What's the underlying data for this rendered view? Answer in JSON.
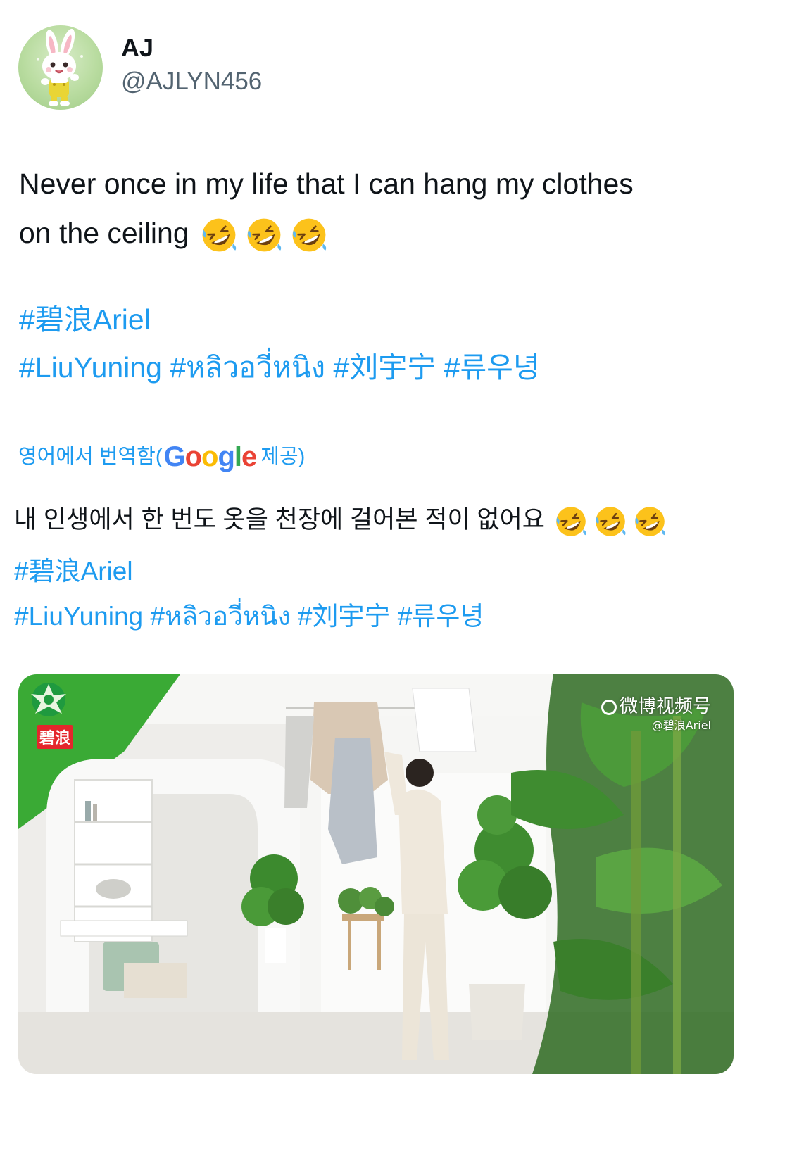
{
  "author": {
    "display_name": "AJ",
    "handle": "@AJLYN456",
    "avatar_icon": "rabbit-avatar"
  },
  "tweet": {
    "text_line1": "Never once in my life that I can hang my clothes",
    "text_line2": "on the ceiling",
    "emoji": "rolling-on-the-floor-laughing",
    "hashtags_line1": [
      "#碧浪Ariel"
    ],
    "hashtags_line2": [
      "#LiuYuning",
      "#หลิวอวี่หนิง",
      "#刘宇宁",
      "#류우녕"
    ]
  },
  "translation": {
    "label_prefix": "영어에서 번역함(",
    "google_logo": "Google",
    "label_suffix": "제공)",
    "text": "내 인생에서 한 번도 옷을 천장에 걸어본 적이 없어요",
    "hashtags_line1": [
      "#碧浪Ariel"
    ],
    "hashtags_line2": [
      "#LiuYuning",
      "#หลิวอวี่หนิง",
      "#刘宇宁",
      "#류우녕"
    ]
  },
  "media": {
    "brand_text": "碧浪",
    "watermark_title": "微博视频号",
    "watermark_sub": "@碧浪Ariel"
  },
  "colors": {
    "link": "#1d9bf0",
    "secondary": "#536471",
    "brand_green": "#3aaa35",
    "brand_red": "#e4262c"
  }
}
